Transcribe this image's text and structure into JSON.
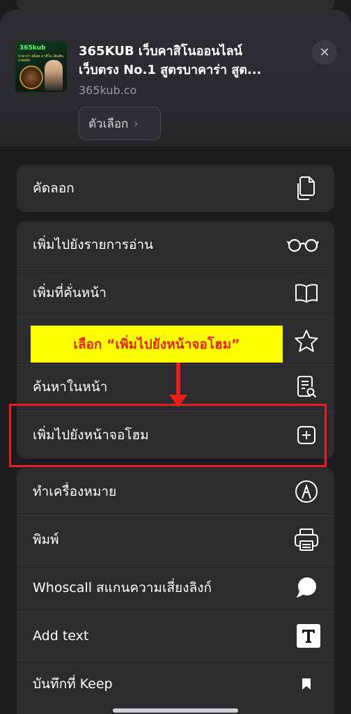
{
  "header": {
    "title_line1": "365KUB เว็บคาสิโนออนไลน์",
    "title_line2": "เว็บตรง No.1 สูตรบาคาร่า สูต...",
    "url": "365kub.co",
    "options_label": "ตัวเลือก",
    "thumbnail": {
      "brand": "365kub",
      "tagline": "บาคาร่า สล็อต คาสิโน เดิมพัน ง่ายหลัก"
    }
  },
  "menu": {
    "copy": {
      "label": "คัดลอก",
      "icon": "copy-icon"
    },
    "add_reading_list": {
      "label": "เพิ่มไปยังรายการอ่าน",
      "icon": "glasses-icon"
    },
    "add_bookmark": {
      "label": "เพิ่มที่คั่นหน้า",
      "icon": "book-icon"
    },
    "add_favorites": {
      "icon": "star-icon"
    },
    "find_on_page": {
      "label": "ค้นหาในหน้า",
      "icon": "find-page-icon"
    },
    "add_home_screen": {
      "label": "เพิ่มไปยังหน้าจอโฮม",
      "icon": "plus-square-icon"
    },
    "markup": {
      "label": "ทำเครื่องหมาย",
      "icon": "markup-pen-icon"
    },
    "print": {
      "label": "พิมพ์",
      "icon": "printer-icon"
    },
    "whoscall": {
      "label": "Whoscall สแกนความเสี่ยงลิงก์",
      "icon": "whoscall-icon"
    },
    "add_text": {
      "label": "Add text",
      "icon": "text-t-icon"
    },
    "keep": {
      "label": "บันทึกที่ Keep",
      "icon": "bookmark-icon"
    }
  },
  "annotation": {
    "callout_text": "เลือก “เพิ่มไปยังหน้าจอโฮม”",
    "color": "#e8201a",
    "background": "#ffff00"
  }
}
